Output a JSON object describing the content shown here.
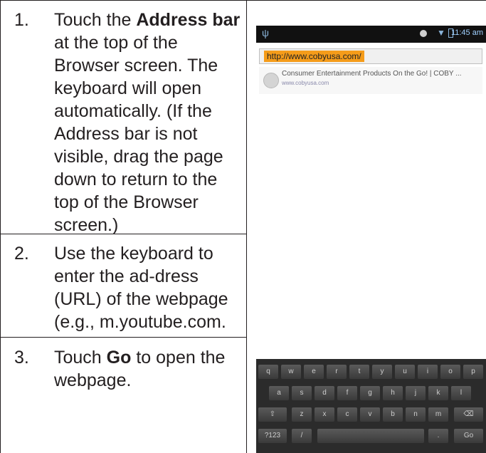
{
  "steps": [
    {
      "number": "1.",
      "parts": [
        "Touch the ",
        "Address bar",
        " at the top of the Browser screen. The keyboard will open automatically. (If the Address bar is not visible, drag the page down to return to the top of the Browser screen.)"
      ]
    },
    {
      "number": "2.",
      "parts": [
        "Use the keyboard to enter the ad-dress (URL) of the webpage (e.g., m.youtube.com."
      ]
    },
    {
      "number": "3.",
      "parts": [
        "Touch ",
        "Go",
        " to open the webpage."
      ]
    }
  ],
  "screenshot": {
    "status_time": "11:45 am",
    "address_url": "http://www.cobyusa.com/",
    "suggestion_title": "Consumer Entertainment Products On the Go! | COBY ...",
    "suggestion_url": "www.cobyusa.com",
    "keyboard": {
      "row1": [
        "q",
        "w",
        "e",
        "r",
        "t",
        "y",
        "u",
        "i",
        "o",
        "p"
      ],
      "row2": [
        "a",
        "s",
        "d",
        "f",
        "g",
        "h",
        "j",
        "k",
        "l"
      ],
      "row3": [
        "⇧",
        "z",
        "x",
        "c",
        "v",
        "b",
        "n",
        "m",
        "⌫"
      ],
      "row4": [
        "?123",
        "/",
        "",
        "",
        ".",
        "Go"
      ]
    }
  }
}
